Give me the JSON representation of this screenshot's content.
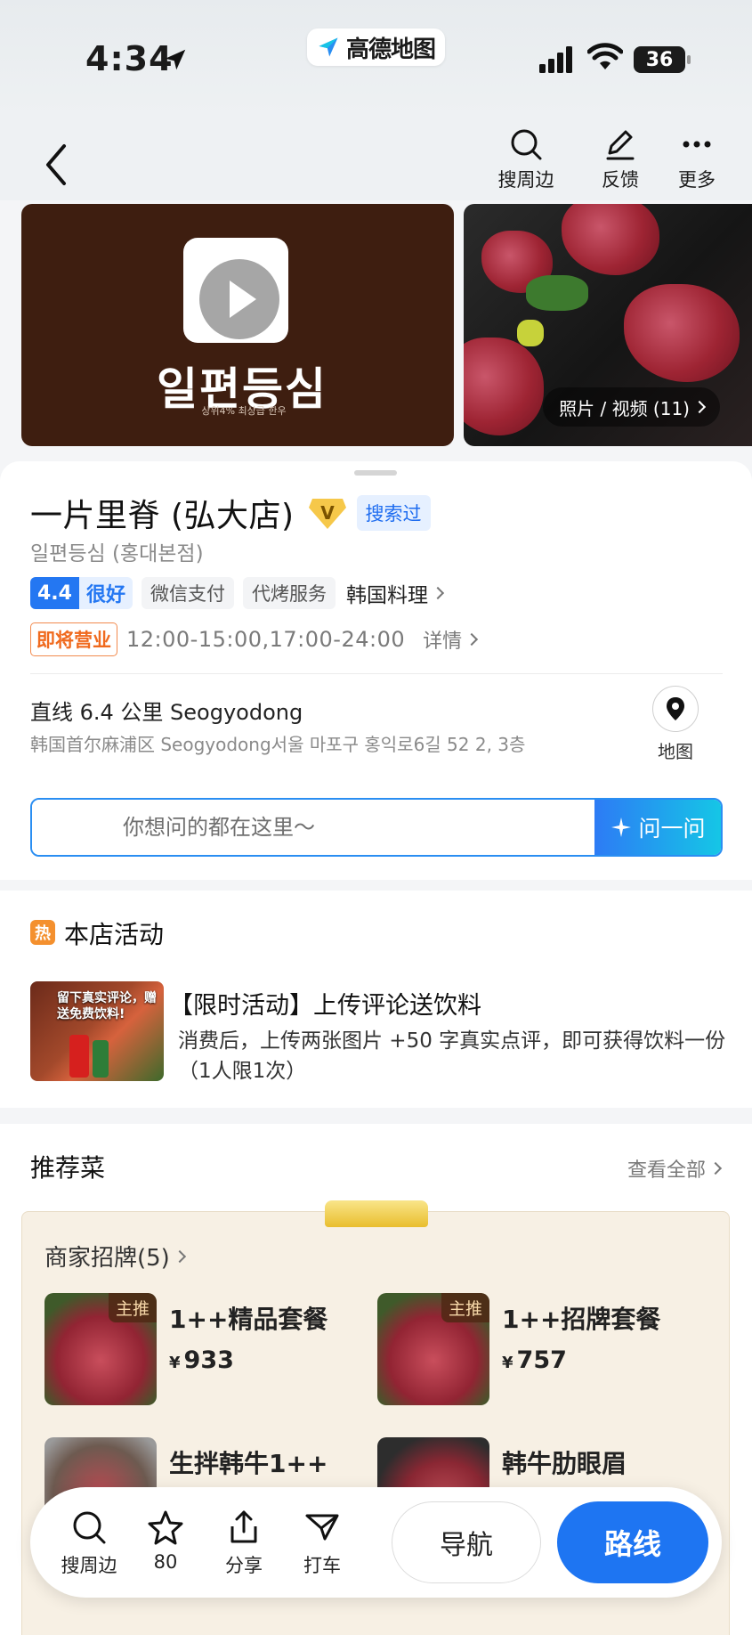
{
  "status_bar": {
    "time": "4:34",
    "app_name": "高德地图",
    "battery": "36"
  },
  "header": {
    "actions": [
      {
        "label": "搜周边",
        "icon": "search-icon"
      },
      {
        "label": "反馈",
        "icon": "edit-icon"
      },
      {
        "label": "更多",
        "icon": "more-icon"
      }
    ]
  },
  "media": {
    "video_logo_text": "일편등심",
    "video_logo_sub": "상위4% 최상급 한우",
    "photo_count_label": "照片 / 视频 (11)"
  },
  "place": {
    "name": "一片里脊 (弘大店)",
    "verified_badge": "V",
    "searched_tag": "搜索过",
    "local_name": "일편등심 (홍대본점)",
    "rating_score": "4.4",
    "rating_level": "很好",
    "tags": [
      "微信支付",
      "代烤服务"
    ],
    "category": "韩国料理",
    "open_status": "即将营业",
    "hours": "12:00-15:00,17:00-24:00",
    "details_label": "详情",
    "distance": "直线 6.4 公里 Seogyodong",
    "address": "韩国首尔麻浦区 Seogyodong서울 마포구 홍익로6길 52 2, 3층",
    "map_label": "地图"
  },
  "ask": {
    "placeholder": "你想问的都在这里～",
    "button_label": "问一问"
  },
  "activity": {
    "hot_icon_text": "热",
    "section_title": "本店活动",
    "image_caption": "留下真实评论，赠送免费饮料!",
    "title": "【限时活动】上传评论送饮料",
    "description": "消费后，上传两张图片 +50 字真实点评，即可获得饮料一份（1人限1次）"
  },
  "recommend": {
    "section_title": "推荐菜",
    "see_all": "查看全部",
    "brand_label": "商家招牌(5)",
    "dishes": [
      {
        "name": "1++精品套餐",
        "price": "933",
        "badge": "主推"
      },
      {
        "name": "1++招牌套餐",
        "price": "757",
        "badge": "主推"
      },
      {
        "name": "生拌韩牛1++",
        "price": "",
        "badge": ""
      },
      {
        "name": "韩牛肋眼眉",
        "price": "",
        "badge": ""
      }
    ],
    "currency": "¥"
  },
  "bottom_bar": {
    "search_label": "搜周边",
    "favorite_count": "80",
    "share_label": "分享",
    "taxi_label": "打车",
    "navigate_label": "导航",
    "route_label": "路线"
  }
}
